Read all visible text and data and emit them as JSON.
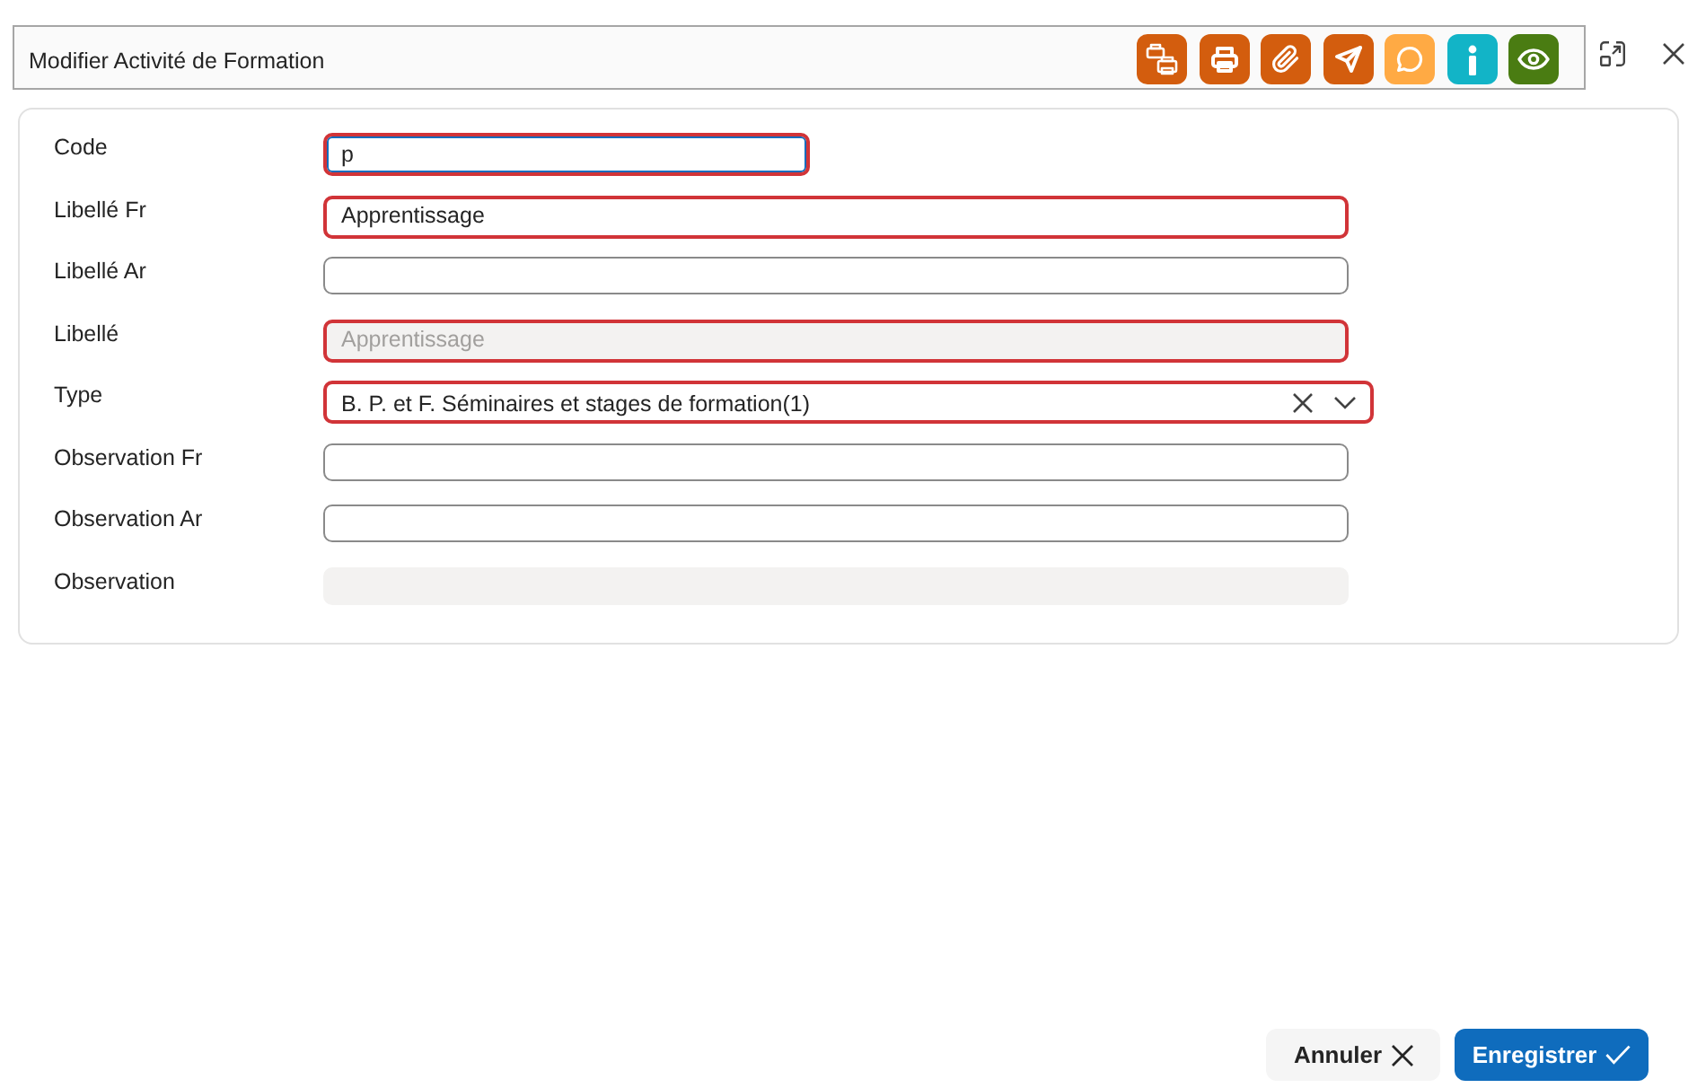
{
  "window": {
    "title": "Modifier Activité de Formation"
  },
  "toolbar": [
    {
      "kind": "printers",
      "color": "#d35d0e"
    },
    {
      "kind": "printer",
      "color": "#d35d0e"
    },
    {
      "kind": "paperclip",
      "color": "#d35d0e"
    },
    {
      "kind": "send",
      "color": "#d35d0e"
    },
    {
      "kind": "comment",
      "color": "#ffaa44"
    },
    {
      "kind": "info",
      "color": "#12b4c7"
    },
    {
      "kind": "eye",
      "color": "#4a7c12"
    }
  ],
  "fields": [
    {
      "label": "Code",
      "kind": "short",
      "value": "p",
      "invalid": true,
      "focused": true,
      "disabled": false
    },
    {
      "label": "Libellé Fr",
      "kind": "text",
      "value": "Apprentissage",
      "invalid": true,
      "focused": false,
      "disabled": false
    },
    {
      "label": "Libellé Ar",
      "kind": "text",
      "invalid": false,
      "focused": false,
      "disabled": false
    },
    {
      "label": "Libellé",
      "kind": "text",
      "value": "Apprentissage",
      "invalid": true,
      "focused": false,
      "disabled": true
    },
    {
      "label": "Type",
      "kind": "select",
      "value": "B. P. et F. Séminaires et stages de formation(1)",
      "invalid": true,
      "focused": false,
      "disabled": false
    },
    {
      "label": "Observation Fr",
      "kind": "text",
      "invalid": false,
      "focused": false,
      "disabled": false
    },
    {
      "label": "Observation Ar",
      "kind": "text",
      "invalid": false,
      "focused": false,
      "disabled": false
    },
    {
      "label": "Observation",
      "kind": "text",
      "invalid": false,
      "focused": false,
      "disabled": true
    }
  ],
  "buttons": [
    {
      "label": "Annuler",
      "kind": "secondary"
    },
    {
      "label": "Enregistrer",
      "kind": "primary"
    }
  ]
}
